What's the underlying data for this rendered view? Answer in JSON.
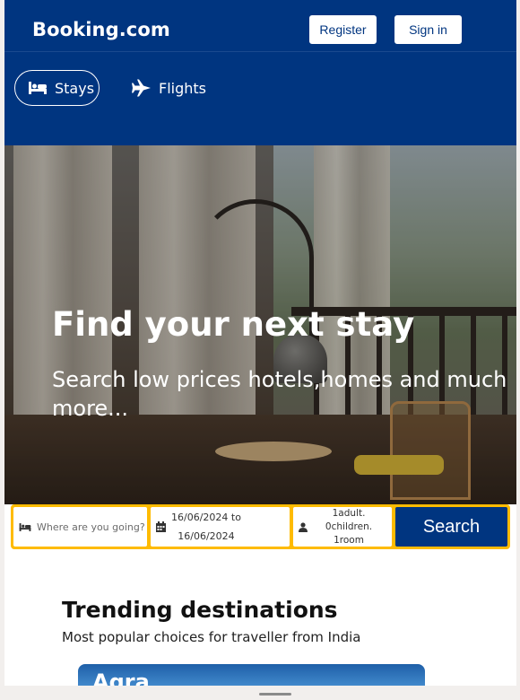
{
  "header": {
    "logo": "Booking.com",
    "register_label": "Register",
    "signin_label": "Sign in",
    "tabs": [
      {
        "label": "Stays",
        "icon": "bed-icon",
        "active": true
      },
      {
        "label": "Flights",
        "icon": "airplane-icon",
        "active": false
      }
    ]
  },
  "hero": {
    "title": "Find your next stay",
    "subtitle": "Search low prices hotels,homes and much more..."
  },
  "search": {
    "destination_placeholder": "Where are you going?",
    "date_from": "16/06/2024 to",
    "date_to": "16/06/2024",
    "guests_line1": "1adult.",
    "guests_line2": "0children.",
    "guests_line3": "1room",
    "button_label": "Search"
  },
  "trending": {
    "title": "Trending destinations",
    "subtitle": "Most popular choices for traveller from India",
    "cards": [
      {
        "label": "Agra"
      }
    ]
  },
  "colors": {
    "brand": "#003580",
    "accent": "#febb02"
  }
}
